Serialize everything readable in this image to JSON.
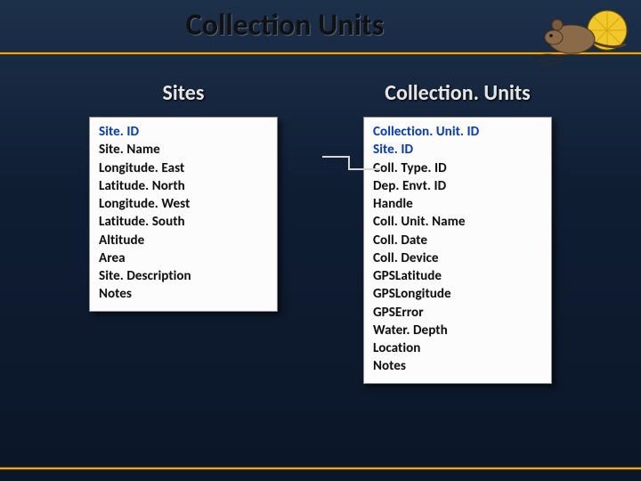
{
  "header": {
    "title": "Collection Units"
  },
  "entities": {
    "sites": {
      "heading": "Sites",
      "fields": [
        {
          "name": "Site. ID",
          "pk": true
        },
        {
          "name": "Site. Name",
          "pk": false
        },
        {
          "name": "Longitude. East",
          "pk": false
        },
        {
          "name": "Latitude. North",
          "pk": false
        },
        {
          "name": "Longitude. West",
          "pk": false
        },
        {
          "name": "Latitude. South",
          "pk": false
        },
        {
          "name": "Altitude",
          "pk": false
        },
        {
          "name": "Area",
          "pk": false
        },
        {
          "name": "Site. Description",
          "pk": false
        },
        {
          "name": "Notes",
          "pk": false
        }
      ]
    },
    "collectionUnits": {
      "heading": "Collection. Units",
      "fields": [
        {
          "name": "Collection. Unit. ID",
          "pk": true
        },
        {
          "name": "Site. ID",
          "pk": true
        },
        {
          "name": "Coll. Type. ID",
          "pk": false
        },
        {
          "name": "Dep. Envt. ID",
          "pk": false
        },
        {
          "name": "Handle",
          "pk": false
        },
        {
          "name": "Coll. Unit. Name",
          "pk": false
        },
        {
          "name": "Coll. Date",
          "pk": false
        },
        {
          "name": "Coll. Device",
          "pk": false
        },
        {
          "name": "GPSLatitude",
          "pk": false
        },
        {
          "name": "GPSLongitude",
          "pk": false
        },
        {
          "name": "GPSError",
          "pk": false
        },
        {
          "name": "Water. Depth",
          "pk": false
        },
        {
          "name": "Location",
          "pk": false
        },
        {
          "name": "Notes",
          "pk": false
        }
      ]
    }
  },
  "logo": {
    "alt": "mouse-and-pollen-logo",
    "pollen_color": "#f2c72b",
    "fur_color": "#8b6a4a",
    "whisker_color": "#3a2a1a"
  }
}
